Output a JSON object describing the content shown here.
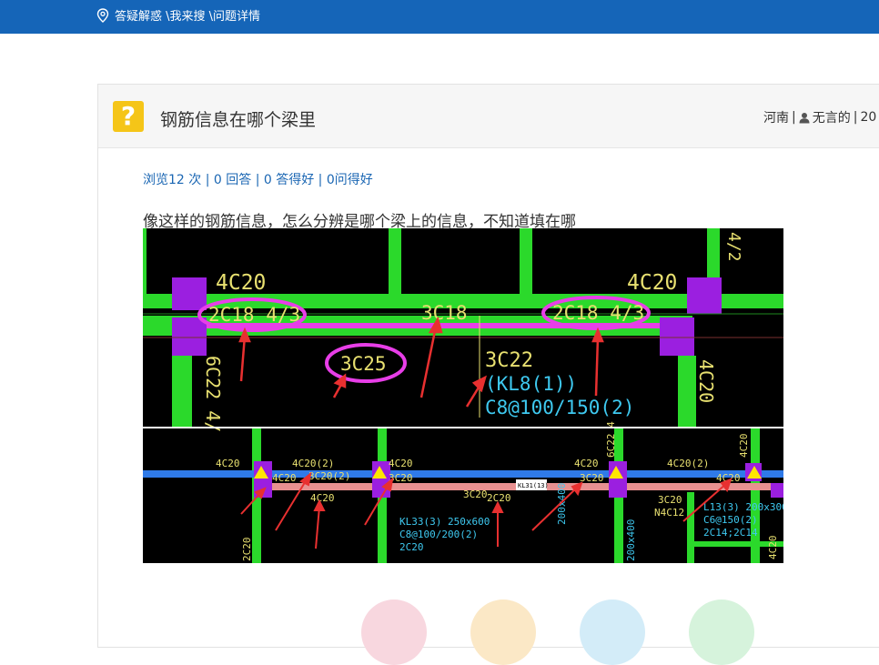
{
  "breadcrumb": {
    "text": "答疑解惑 \\我来搜 \\问题详情",
    "icon": "location-pin-icon"
  },
  "question": {
    "title": "钢筋信息在哪个梁里",
    "region": "河南",
    "separator": "|",
    "user_icon": "user-icon",
    "username": "无言的",
    "date_fragment": "20",
    "stats": "浏览12 次 | 0 回答 | 0 答得好 | 0问得好",
    "body": "像这样的钢筋信息，怎么分辨是哪个梁上的信息，不知道填在哪"
  },
  "drawing": {
    "top": {
      "label_left": "4C20",
      "label_right": "4C20",
      "circle_left": "2C18 4/3",
      "circle_right": "2C18 4/3",
      "mid": "3C18",
      "circle_center": "3C25",
      "beam_bottom": "3C22",
      "beam_name": "(KL8(1))",
      "stirrup": "C8@100/150(2)",
      "col_left_vertical": "6C22 4/",
      "col_right_vertical": "4C20",
      "corner_right": "4/2"
    },
    "bottom": {
      "l1": "4C20",
      "l2": "4C20(2)",
      "l3": "4C20",
      "l4": "3C20(2)",
      "l5": "4C20",
      "l6": "3C20",
      "l7": "4C20",
      "l8": "2C20",
      "l9": "4C20",
      "l10": "3C20",
      "l11": "4C20(2)",
      "l12": "4C20",
      "l13": "3C20",
      "l14": "4C20",
      "tag": "KL31(13)",
      "spec1": "KL33(3) 250x600",
      "spec2": "C8@100/200(2)",
      "spec3": "2C20",
      "spec4": "L13(3) 200x300",
      "spec5": "C6@150(2)",
      "spec6": "2C14;2C14",
      "n1": "3C20",
      "n2": "N4C12",
      "v1": "6C22 4",
      "v2": "4C20",
      "v3": "2C20",
      "v4": "200x400",
      "v5": "200x400"
    },
    "colors": {
      "beam": "#2bd92b",
      "column": "#9b1fe0",
      "highlight": "#e83ee8",
      "text": "#e8e070",
      "cyan": "#3ec9f0",
      "arrow": "#e83030",
      "blue_beam": "#2f7ae8",
      "salmon_beam": "#e89090"
    }
  },
  "action_circles": {
    "colors": [
      "#f8d7df",
      "#fbe8c6",
      "#d3ecf8",
      "#d6f3dc"
    ]
  }
}
